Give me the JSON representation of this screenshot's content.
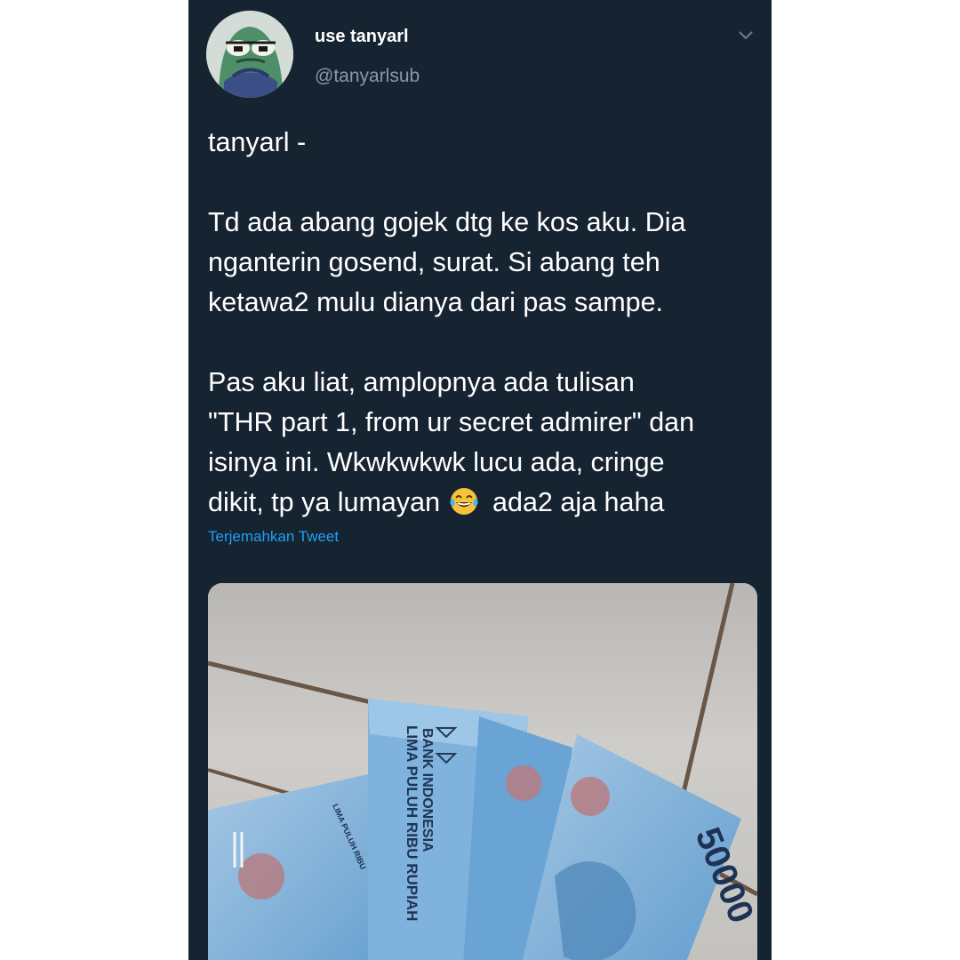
{
  "tweet": {
    "display_name": "use tanyarl",
    "handle": "@tanyarlsub",
    "lines": [
      "tanyarl -",
      "",
      "Td ada abang gojek dtg ke kos aku. Dia",
      "nganterin gosend, surat. Si abang teh",
      "ketawa2 mulu dianya dari pas sampe.",
      "",
      "Pas aku liat, amplopnya ada tulisan",
      "\"THR part 1, from ur secret admirer\" dan",
      "isinya ini. Wkwkwkwk lucu ada, cringe"
    ],
    "last_line_before_emoji": "dikit, tp ya lumayan",
    "last_line_after_emoji": "ada2 aja haha",
    "translate_label": "Terjemahkan Tweet",
    "icons": {
      "avatar": "frog-avatar",
      "menu": "chevron-down-icon",
      "emoji": "tears-of-joy-emoji"
    }
  },
  "media": {
    "banknote_texts": {
      "issuer": "BANK INDONESIA",
      "amount_words": "LIMA PULUH RIBU RUPIAH",
      "denomination": "50000",
      "small_caption": "LIMA PULUH RIBU"
    }
  },
  "colors": {
    "tweet_background": "#162331",
    "link": "#1da1f2",
    "secondary_text": "#8899a6"
  }
}
